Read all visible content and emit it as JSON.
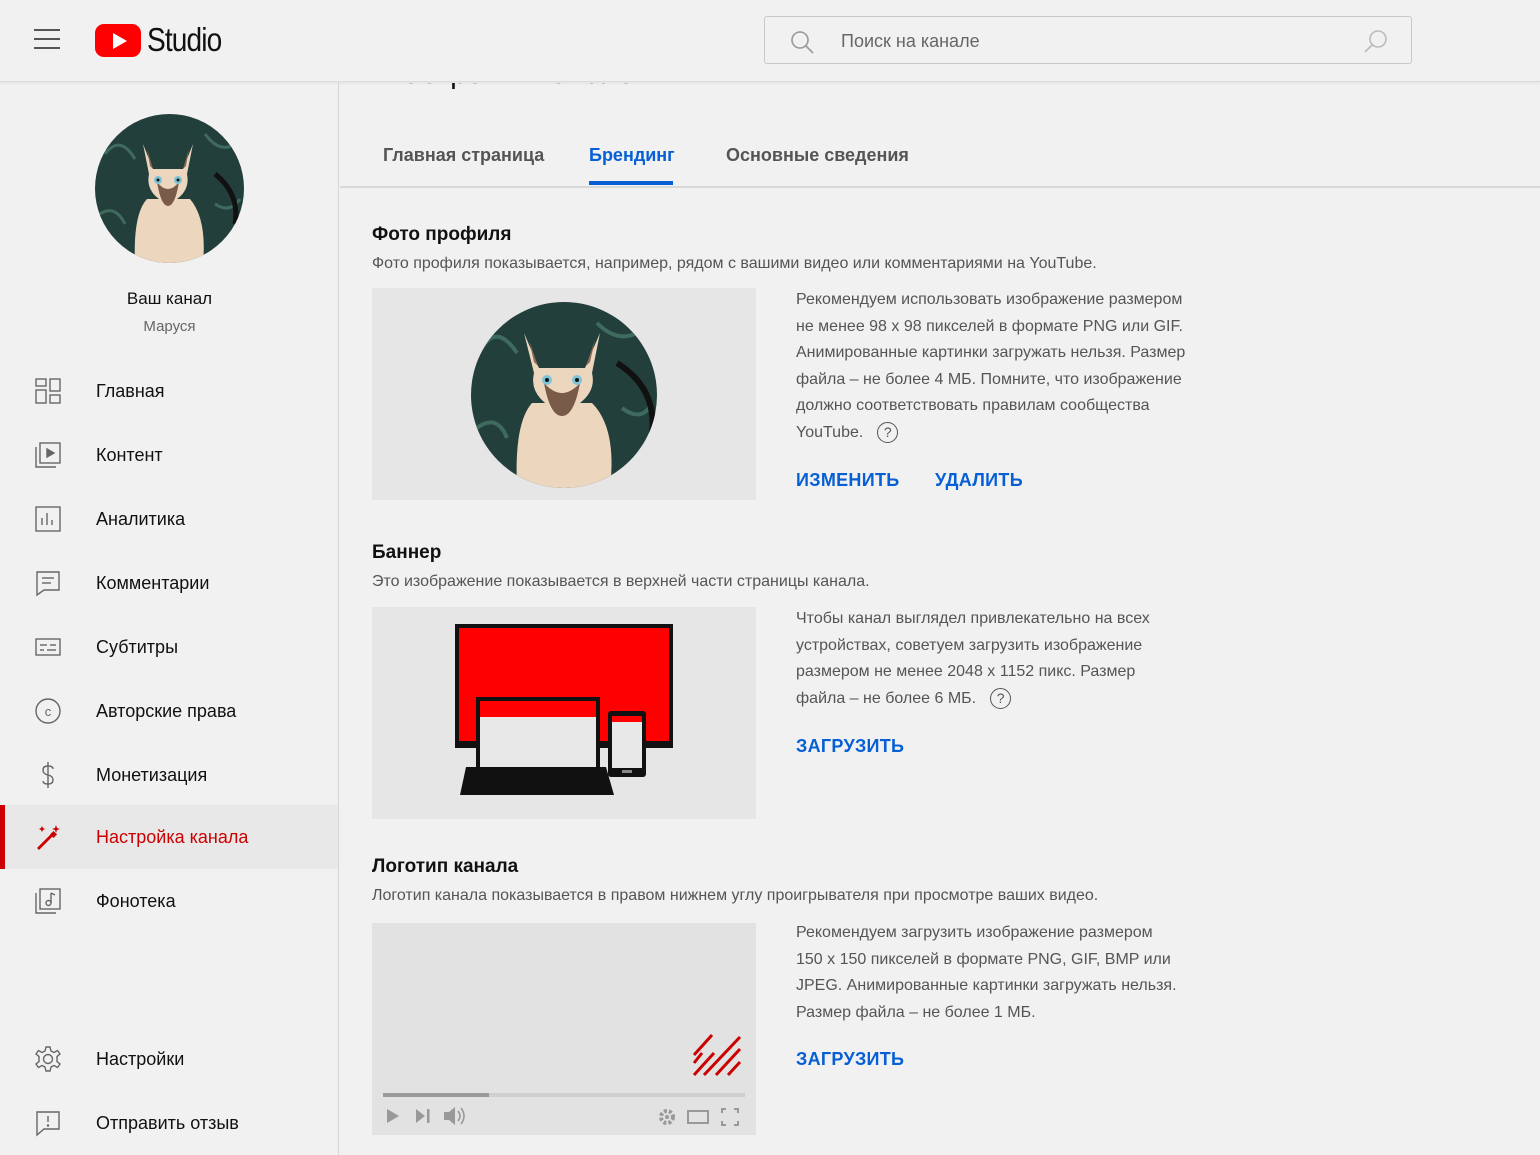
{
  "header": {
    "logo_text": "Studio",
    "search_placeholder": "Поиск на канале"
  },
  "sidebar": {
    "channel_title": "Ваш канал",
    "channel_name": "Маруся",
    "items": [
      {
        "label": "Главная",
        "icon": "dashboard-icon"
      },
      {
        "label": "Контент",
        "icon": "content-icon"
      },
      {
        "label": "Аналитика",
        "icon": "analytics-icon"
      },
      {
        "label": "Комментарии",
        "icon": "comments-icon"
      },
      {
        "label": "Субтитры",
        "icon": "subtitles-icon"
      },
      {
        "label": "Авторские права",
        "icon": "copyright-icon"
      },
      {
        "label": "Монетизация",
        "icon": "dollar-icon"
      },
      {
        "label": "Настройка канала",
        "icon": "magic-wand-icon",
        "active": true
      },
      {
        "label": "Фонотека",
        "icon": "audio-library-icon"
      }
    ],
    "bottom_items": [
      {
        "label": "Настройки",
        "icon": "gear-icon"
      },
      {
        "label": "Отправить отзыв",
        "icon": "feedback-icon"
      }
    ]
  },
  "main": {
    "page_title": "Настройки канала",
    "tabs": [
      {
        "label": "Главная страница"
      },
      {
        "label": "Брендинг",
        "active": true
      },
      {
        "label": "Основные сведения"
      }
    ],
    "profile_photo": {
      "title": "Фото профиля",
      "description": "Фото профиля показывается, например, рядом с вашими видео или комментариями на YouTube.",
      "hint_lines": [
        "Рекомендуем использовать изображение размером",
        "не менее 98 x 98 пикселей в формате PNG или GIF.",
        "Анимированные картинки загружать нельзя. Размер",
        "файла – не более 4 МБ. Помните, что изображение",
        "должно соответствовать правилам сообщества",
        "YouTube."
      ],
      "change_label": "ИЗМЕНИТЬ",
      "delete_label": "УДАЛИТЬ"
    },
    "banner": {
      "title": "Баннер",
      "description": "Это изображение показывается в верхней части страницы канала.",
      "hint_lines": [
        "Чтобы канал выглядел привлекательно на всех",
        "устройствах, советуем загрузить изображение",
        "размером не менее 2048 x 1152 пикс. Размер",
        "файла – не более 6 МБ."
      ],
      "upload_label": "ЗАГРУЗИТЬ"
    },
    "logo": {
      "title": "Логотип канала",
      "description": "Логотип канала показывается в правом нижнем углу проигрывателя при просмотре ваших видео.",
      "hint_lines": [
        "Рекомендуем загрузить изображение размером",
        "150 x 150 пикселей в формате PNG, GIF, BMP или",
        "JPEG. Анимированные картинки загружать нельзя.",
        "Размер файла – не более 1 МБ."
      ],
      "upload_label": "ЗАГРУЗИТЬ"
    },
    "help_mark": "?"
  },
  "colors": {
    "accent_blue": "#065fd4",
    "brand_red": "#ff0000",
    "active_red": "#cc0000"
  }
}
